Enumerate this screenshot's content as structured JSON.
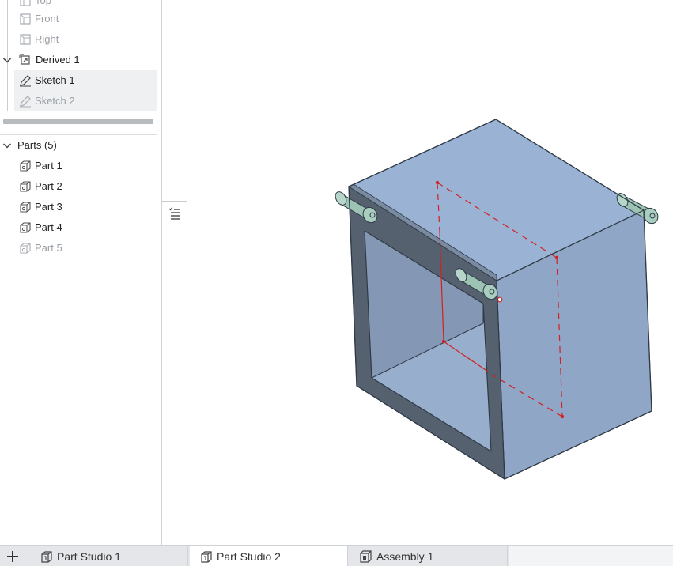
{
  "feature_tree": {
    "planes": [
      {
        "label": "Top"
      },
      {
        "label": "Front"
      },
      {
        "label": "Right"
      }
    ],
    "derived": {
      "label": "Derived 1"
    },
    "sketches": [
      {
        "label": "Sketch 1"
      },
      {
        "label": "Sketch 2"
      }
    ]
  },
  "parts_list": {
    "header": "Parts (5)",
    "items": [
      {
        "label": "Part 1"
      },
      {
        "label": "Part 2"
      },
      {
        "label": "Part 3"
      },
      {
        "label": "Part 4"
      },
      {
        "label": "Part 5"
      }
    ]
  },
  "tabs": [
    {
      "label": "Part Studio 1",
      "icon": "part-studio-icon",
      "active": false
    },
    {
      "label": "Part Studio 2",
      "icon": "part-studio-icon",
      "active": true
    },
    {
      "label": "Assembly 1",
      "icon": "assembly-icon",
      "active": false
    }
  ],
  "colors": {
    "part_face_top": "#9ab3d4",
    "part_face_side": "#8fa6c6",
    "part_edge": "#53606e",
    "pin": "#9cc3b4",
    "sketch": "#d42020"
  }
}
